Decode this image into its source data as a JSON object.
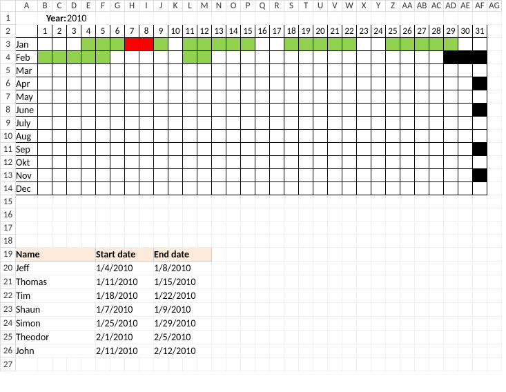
{
  "colLetters": [
    "A",
    "B",
    "C",
    "D",
    "E",
    "F",
    "G",
    "H",
    "I",
    "J",
    "K",
    "L",
    "M",
    "N",
    "O",
    "P",
    "Q",
    "R",
    "S",
    "T",
    "U",
    "V",
    "W",
    "X",
    "Y",
    "Z",
    "AA",
    "AB",
    "AC",
    "AD",
    "AE",
    "AF",
    "AG"
  ],
  "rowNumbers": [
    1,
    2,
    3,
    4,
    5,
    6,
    7,
    8,
    9,
    10,
    11,
    12,
    13,
    14,
    15,
    16,
    17,
    18,
    19,
    20,
    21,
    22,
    23,
    24,
    25,
    26,
    27
  ],
  "yearLabel": "Year:",
  "yearValue": "2010",
  "days": [
    1,
    2,
    3,
    4,
    5,
    6,
    7,
    8,
    9,
    10,
    11,
    12,
    13,
    14,
    15,
    16,
    17,
    18,
    19,
    20,
    21,
    22,
    23,
    24,
    25,
    26,
    27,
    28,
    29,
    30,
    31
  ],
  "months": [
    "Jan",
    "Feb",
    "Mar",
    "Apr",
    "May",
    "June",
    "July",
    "Aug",
    "Sep",
    "Okt",
    "Nov",
    "Dec"
  ],
  "calendar": {
    "Jan": {
      "4": "green",
      "5": "green",
      "6": "green",
      "7": "red",
      "8": "red",
      "9": "green",
      "11": "green",
      "12": "green",
      "13": "green",
      "14": "green",
      "15": "green",
      "18": "green",
      "19": "green",
      "20": "green",
      "21": "green",
      "22": "green",
      "25": "green",
      "26": "green",
      "27": "green",
      "28": "green",
      "29": "green"
    },
    "Feb": {
      "1": "green",
      "2": "green",
      "3": "green",
      "4": "green",
      "5": "green",
      "11": "green",
      "12": "green",
      "29": "black",
      "30": "black",
      "31": "black"
    },
    "Apr": {
      "31": "black"
    },
    "June": {
      "31": "black"
    },
    "Sep": {
      "31": "black"
    },
    "Nov": {
      "31": "black"
    }
  },
  "table": {
    "headers": [
      "Name",
      "Start date",
      "End date"
    ],
    "rows": [
      [
        "Jeff",
        "1/4/2010",
        "1/8/2010"
      ],
      [
        "Thomas",
        "1/11/2010",
        "1/15/2010"
      ],
      [
        "Tim",
        "1/18/2010",
        "1/22/2010"
      ],
      [
        "Shaun",
        "1/7/2010",
        "1/9/2010"
      ],
      [
        "Simon",
        "1/25/2010",
        "1/29/2010"
      ],
      [
        "Theodor",
        "2/1/2010",
        "2/5/2010"
      ],
      [
        "John",
        "2/11/2010",
        "2/12/2010"
      ]
    ]
  }
}
